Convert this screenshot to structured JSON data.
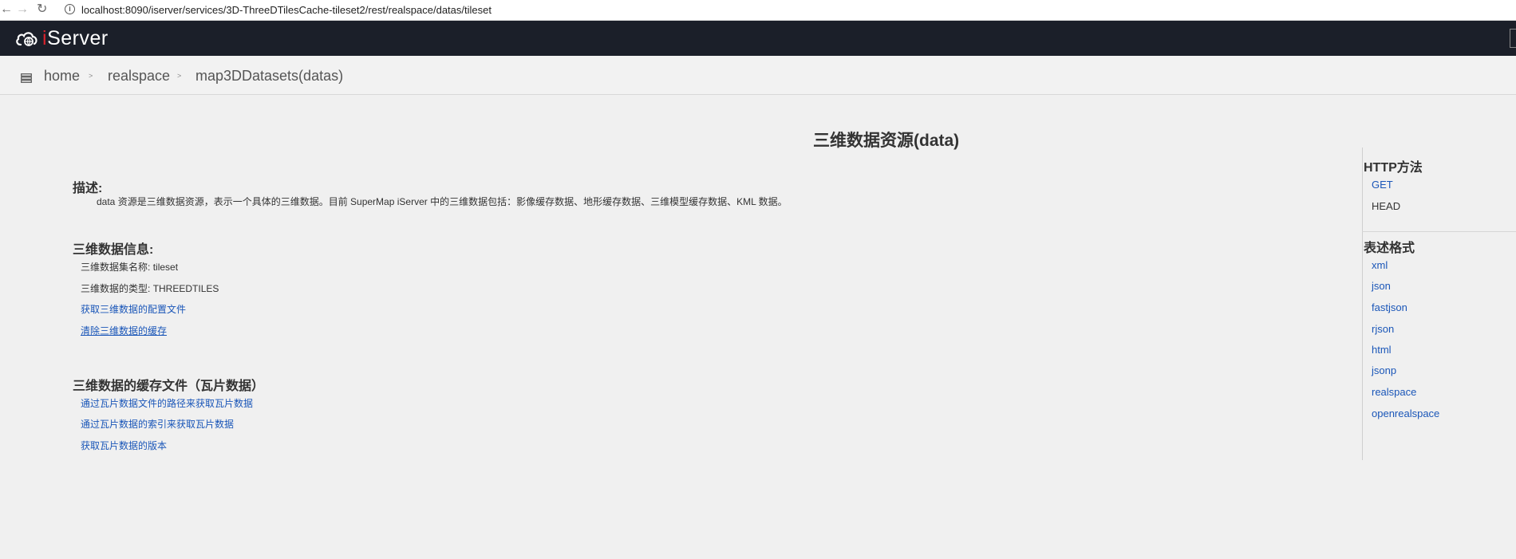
{
  "browser": {
    "back_icon": "←",
    "forward_icon": "→",
    "reload_icon": "↻",
    "info_icon": "i",
    "url": "localhost:8090/iserver/services/3D-ThreeDTilesCache-tileset2/rest/realspace/datas/tileset"
  },
  "header": {
    "logo_text": "Server",
    "logo_i": "i"
  },
  "breadcrumb": {
    "items": [
      {
        "label": "home"
      },
      {
        "label": "realspace"
      },
      {
        "label": "map3DDatasets(datas)"
      }
    ],
    "separator": ">"
  },
  "main": {
    "title": "三维数据资源(data)",
    "description": {
      "heading": "描述:",
      "text": "data 资源是三维数据资源，表示一个具体的三维数据。目前 SuperMap iServer 中的三维数据包括：影像缓存数据、地形缓存数据、三维模型缓存数据、KML 数据。"
    },
    "info": {
      "heading": "三维数据信息:",
      "dataset_name_label": "三维数据集名称:",
      "dataset_name_value": "tileset",
      "data_type_label": "三维数据的类型:",
      "data_type_value": "THREEDTILES",
      "link_config": "获取三维数据的配置文件",
      "link_clear_cache": "清除三维数据的缓存"
    },
    "cache": {
      "heading": "三维数据的缓存文件（瓦片数据）",
      "links": [
        "通过瓦片数据文件的路径来获取瓦片数据",
        "通过瓦片数据的索引来获取瓦片数据",
        "获取瓦片数据的版本"
      ]
    }
  },
  "sidebar": {
    "http_title": "HTTP方法",
    "http_methods": [
      {
        "label": "GET",
        "link": true
      },
      {
        "label": "HEAD",
        "link": false
      }
    ],
    "format_title": "表述格式",
    "formats": [
      "xml",
      "json",
      "fastjson",
      "rjson",
      "html",
      "jsonp",
      "realspace",
      "openrealspace"
    ]
  },
  "colors": {
    "header_bg": "#1b1f29",
    "link": "#1a56b8",
    "logo_accent": "#d9232d"
  }
}
